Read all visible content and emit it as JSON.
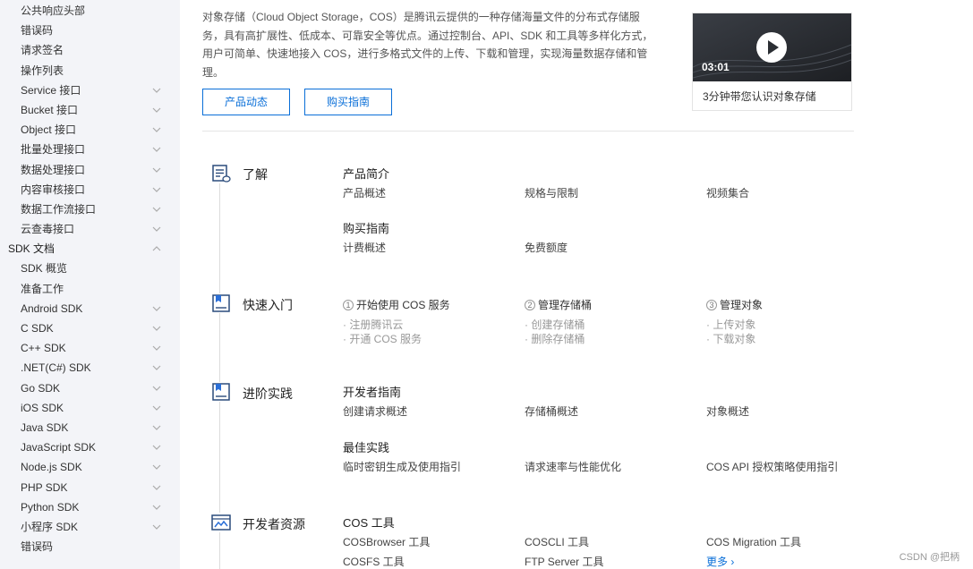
{
  "sidebar": {
    "items": [
      {
        "label": "公共响应头部",
        "level": "sub",
        "chevron": "none"
      },
      {
        "label": "错误码",
        "level": "sub",
        "chevron": "none"
      },
      {
        "label": "请求签名",
        "level": "sub",
        "chevron": "none"
      },
      {
        "label": "操作列表",
        "level": "sub",
        "chevron": "none"
      },
      {
        "label": "Service 接口",
        "level": "sub",
        "chevron": "down"
      },
      {
        "label": "Bucket 接口",
        "level": "sub",
        "chevron": "down"
      },
      {
        "label": "Object 接口",
        "level": "sub",
        "chevron": "down"
      },
      {
        "label": "批量处理接口",
        "level": "sub",
        "chevron": "down"
      },
      {
        "label": "数据处理接口",
        "level": "sub",
        "chevron": "down"
      },
      {
        "label": "内容审核接口",
        "level": "sub",
        "chevron": "down"
      },
      {
        "label": "数据工作流接口",
        "level": "sub",
        "chevron": "down"
      },
      {
        "label": "云查毒接口",
        "level": "sub",
        "chevron": "down"
      },
      {
        "label": "SDK 文档",
        "level": "top",
        "chevron": "up"
      },
      {
        "label": "SDK 概览",
        "level": "sub",
        "chevron": "none"
      },
      {
        "label": "准备工作",
        "level": "sub",
        "chevron": "none"
      },
      {
        "label": "Android SDK",
        "level": "sub",
        "chevron": "down"
      },
      {
        "label": "C SDK",
        "level": "sub",
        "chevron": "down"
      },
      {
        "label": "C++ SDK",
        "level": "sub",
        "chevron": "down"
      },
      {
        "label": ".NET(C#) SDK",
        "level": "sub",
        "chevron": "down"
      },
      {
        "label": "Go SDK",
        "level": "sub",
        "chevron": "down"
      },
      {
        "label": "iOS SDK",
        "level": "sub",
        "chevron": "down"
      },
      {
        "label": "Java SDK",
        "level": "sub",
        "chevron": "down"
      },
      {
        "label": "JavaScript SDK",
        "level": "sub",
        "chevron": "down"
      },
      {
        "label": "Node.js SDK",
        "level": "sub",
        "chevron": "down"
      },
      {
        "label": "PHP SDK",
        "level": "sub",
        "chevron": "down"
      },
      {
        "label": "Python SDK",
        "level": "sub",
        "chevron": "down"
      },
      {
        "label": "小程序 SDK",
        "level": "sub",
        "chevron": "down"
      },
      {
        "label": "错误码",
        "level": "sub",
        "chevron": "none"
      }
    ]
  },
  "intro": {
    "text": "对象存储（Cloud Object Storage，COS）是腾讯云提供的一种存储海量文件的分布式存储服务，具有高扩展性、低成本、可靠安全等优点。通过控制台、API、SDK 和工具等多样化方式，用户可简单、快速地接入 COS，进行多格式文件的上传、下载和管理，实现海量数据存储和管理。",
    "btn_news": "产品动态",
    "btn_buy": "购买指南"
  },
  "video": {
    "duration": "03:01",
    "caption": "3分钟带您认识对象存储"
  },
  "sections": {
    "learn": {
      "title": "了解",
      "g1_title": "产品简介",
      "g1_links": [
        "产品概述",
        "规格与限制",
        "视频集合"
      ],
      "g2_title": "购买指南",
      "g2_links": [
        "计费概述",
        "免费额度"
      ]
    },
    "quick": {
      "title": "快速入门",
      "steps": [
        {
          "num": "1",
          "label": "开始使用 COS 服务",
          "subs": [
            "· 注册腾讯云",
            "· 开通 COS 服务"
          ]
        },
        {
          "num": "2",
          "label": "管理存储桶",
          "subs": [
            "· 创建存储桶",
            "· 删除存储桶"
          ]
        },
        {
          "num": "3",
          "label": "管理对象",
          "subs": [
            "· 上传对象",
            "· 下载对象"
          ]
        }
      ]
    },
    "advanced": {
      "title": "进阶实践",
      "g1_title": "开发者指南",
      "g1_links": [
        "创建请求概述",
        "存储桶概述",
        "对象概述"
      ],
      "g2_title": "最佳实践",
      "g2_links": [
        "临时密钥生成及使用指引",
        "请求速率与性能优化",
        "COS API 授权策略使用指引"
      ]
    },
    "resources": {
      "title": "开发者资源",
      "g1_title": "COS 工具",
      "g1_links": [
        "COSBrowser 工具",
        "COSCLI 工具",
        "COS Migration 工具"
      ],
      "g1_links2": [
        "COSFS 工具",
        "FTP Server 工具"
      ],
      "more": "更多 ›"
    }
  },
  "watermark": "CSDN @把柄",
  "colors": {
    "accent": "#0a6fd8",
    "sidebar_bg": "#f3f4f8"
  }
}
